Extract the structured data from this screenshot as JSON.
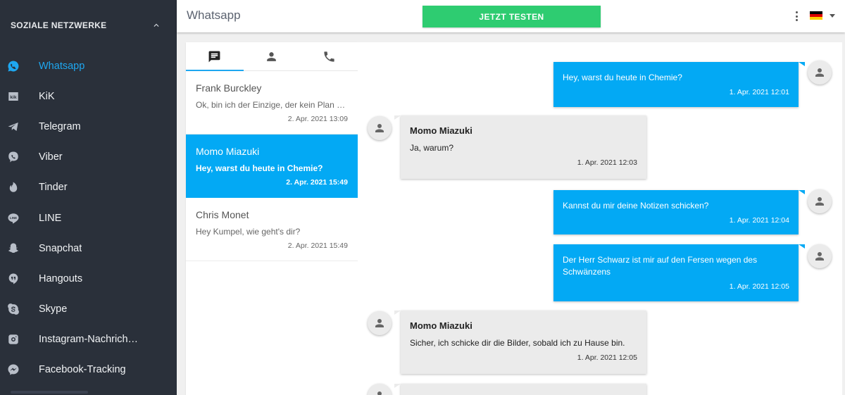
{
  "sidebar": {
    "section_title": "SOZIALE NETZWERKE",
    "items": [
      {
        "label": "Whatsapp",
        "icon": "whatsapp-icon"
      },
      {
        "label": "KiK",
        "icon": "kik-icon"
      },
      {
        "label": "Telegram",
        "icon": "telegram-icon"
      },
      {
        "label": "Viber",
        "icon": "viber-icon"
      },
      {
        "label": "Tinder",
        "icon": "tinder-icon"
      },
      {
        "label": "LINE",
        "icon": "line-icon"
      },
      {
        "label": "Snapchat",
        "icon": "snapchat-icon"
      },
      {
        "label": "Hangouts",
        "icon": "hangouts-icon"
      },
      {
        "label": "Skype",
        "icon": "skype-icon"
      },
      {
        "label": "Instagram-Nachrichten",
        "icon": "instagram-icon"
      },
      {
        "label": "Facebook-Tracking",
        "icon": "messenger-icon"
      }
    ]
  },
  "header": {
    "title": "Whatsapp",
    "cta_label": "JETZT TESTEN",
    "language_flag": "de"
  },
  "tabs": [
    {
      "icon": "chat-icon"
    },
    {
      "icon": "contacts-icon"
    },
    {
      "icon": "calls-icon"
    }
  ],
  "conversations": [
    {
      "name": "Frank Burckley",
      "preview": "Ok, bin ich der Einzige, der kein Plan von Chemie hat?",
      "time": "2. Apr. 2021 13:09"
    },
    {
      "name": "Momo Miazuki",
      "preview": "Hey, warst du heute in Chemie?",
      "time": "2. Apr. 2021 15:49"
    },
    {
      "name": "Chris Monet",
      "preview": "Hey Kumpel, wie geht's dir?",
      "time": "2. Apr. 2021 15:49"
    }
  ],
  "messages": [
    {
      "text": "Hey, warst du heute in Chemie?",
      "time": "1. Apr. 2021 12:01"
    },
    {
      "sender": "Momo Miazuki",
      "text": "Ja, warum?",
      "time": "1. Apr. 2021 12:03"
    },
    {
      "text": "Kannst du mir deine Notizen schicken?",
      "time": "1. Apr. 2021 12:04"
    },
    {
      "text": "Der Herr Schwarz ist mir auf den Fersen wegen des Schwänzens",
      "time": "1. Apr. 2021 12:05"
    },
    {
      "sender": "Momo Miazuki",
      "text": "Sicher, ich schicke dir die Bilder, sobald ich zu Hause bin.",
      "time": "1. Apr. 2021 12:05"
    }
  ],
  "colors": {
    "sidebar_bg": "#2a303a",
    "accent": "#03a9f4",
    "cta": "#2ecc71",
    "incoming_bubble": "#ebebeb"
  }
}
